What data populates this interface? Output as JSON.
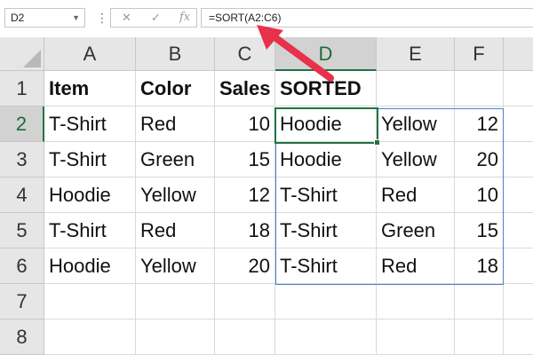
{
  "name_box": {
    "value": "D2"
  },
  "formula_bar": {
    "formula": "=SORT(A2:C6)",
    "buttons": {
      "cancel": "✕",
      "enter": "✓",
      "function": "fx"
    }
  },
  "columns": [
    "A",
    "B",
    "C",
    "D",
    "E",
    "F"
  ],
  "rows": [
    "1",
    "2",
    "3",
    "4",
    "5",
    "6",
    "7",
    "8"
  ],
  "cells": {
    "A1": "Item",
    "B1": "Color",
    "C1": "Sales",
    "D1": "SORTED",
    "A2": "T-Shirt",
    "B2": "Red",
    "C2": "10",
    "A3": "T-Shirt",
    "B3": "Green",
    "C3": "15",
    "A4": "Hoodie",
    "B4": "Yellow",
    "C4": "12",
    "A5": "T-Shirt",
    "B5": "Red",
    "C5": "18",
    "A6": "Hoodie",
    "B6": "Yellow",
    "C6": "20",
    "D2": "Hoodie",
    "E2": "Yellow",
    "F2": "12",
    "D3": "Hoodie",
    "E3": "Yellow",
    "F3": "20",
    "D4": "T-Shirt",
    "E4": "Red",
    "F4": "10",
    "D5": "T-Shirt",
    "E5": "Green",
    "F5": "15",
    "D6": "T-Shirt",
    "E6": "Red",
    "F6": "18"
  },
  "colors": {
    "selection": "#217346",
    "spill_border": "#4e7fd0",
    "annotation_arrow": "#e8314a"
  }
}
